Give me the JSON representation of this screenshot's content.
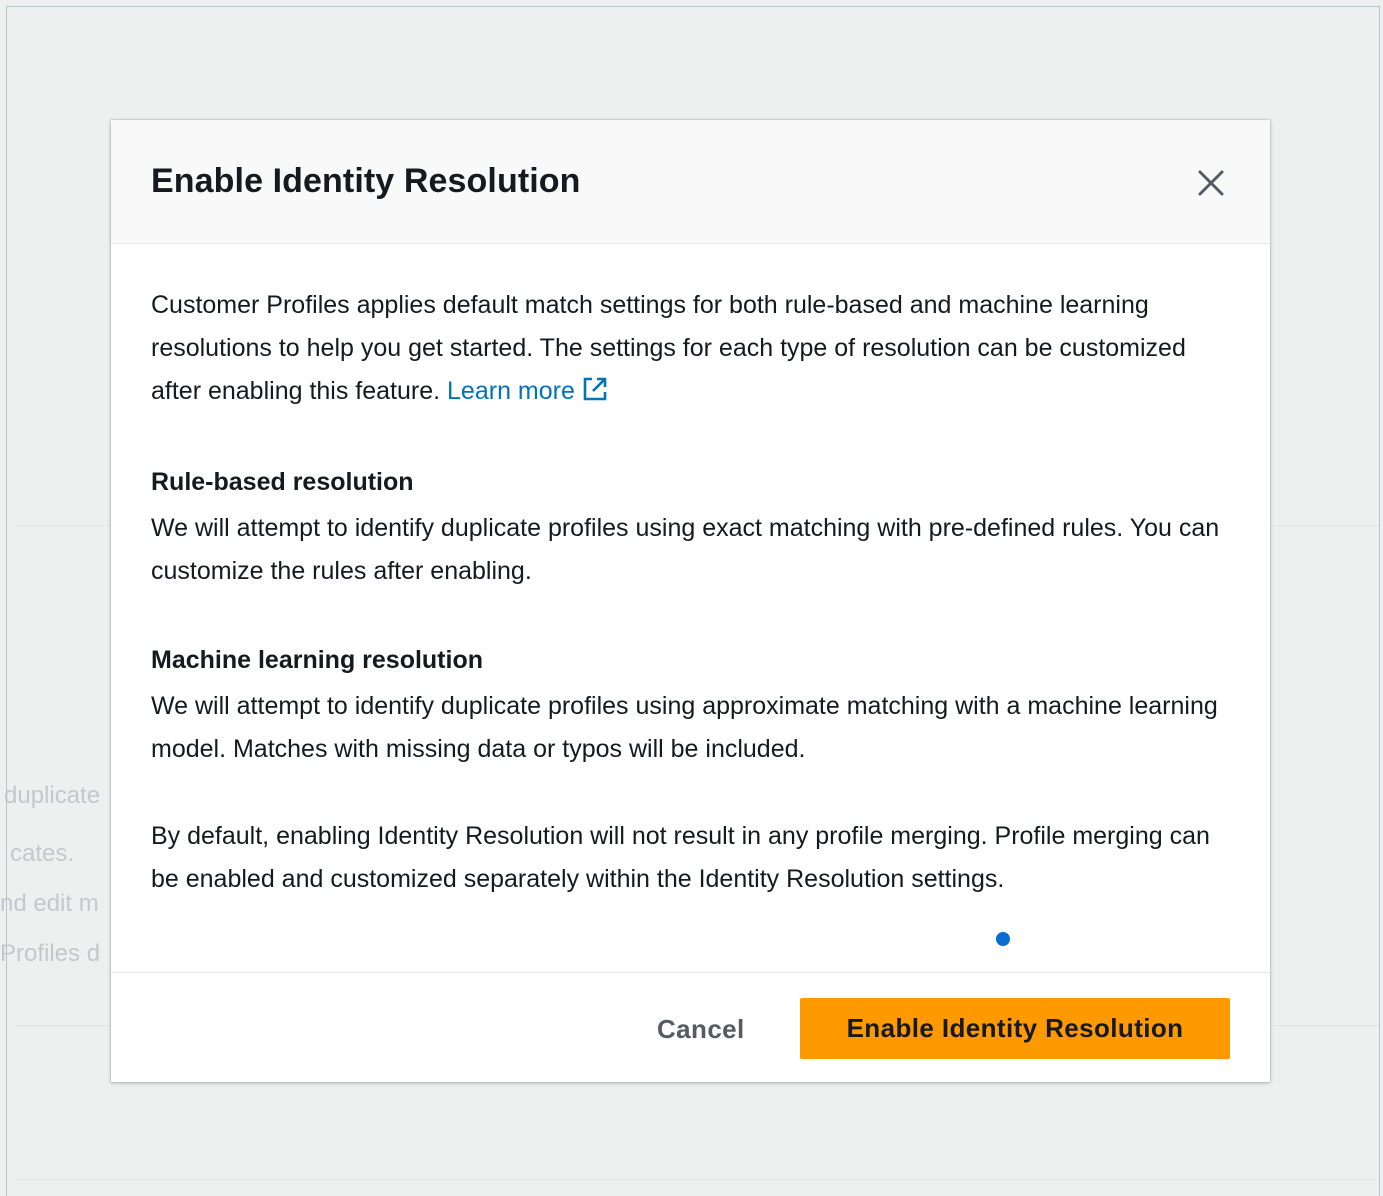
{
  "background": {
    "partial_lines": [
      "duplicate",
      "cates.",
      "nd edit m",
      "Profiles d"
    ]
  },
  "modal": {
    "title": "Enable Identity Resolution",
    "close_icon": "close-icon",
    "intro": "Customer Profiles applies default match settings for both rule-based and machine learning resolutions to help you get started. The settings for each type of resolution can be customized after enabling this feature.",
    "learn_more": "Learn more",
    "external_link_icon": "external-link-icon",
    "rule_based": {
      "title": "Rule-based resolution",
      "text": "We will attempt to identify duplicate profiles using exact matching with pre-defined rules. You can customize the rules after enabling."
    },
    "ml": {
      "title": "Machine learning resolution",
      "text": "We will attempt to identify duplicate profiles using approximate matching with a machine learning model. Matches with missing data or typos will be included."
    },
    "note": "By default, enabling Identity Resolution will not result in any profile merging. Profile merging can be enabled and customized separately within the Identity Resolution settings."
  },
  "footer": {
    "cancel_label": "Cancel",
    "primary_label": "Enable Identity Resolution"
  },
  "colors": {
    "primary": "#ff9900",
    "link": "#0073bb",
    "indicator_dot": "#0a6bd1"
  }
}
